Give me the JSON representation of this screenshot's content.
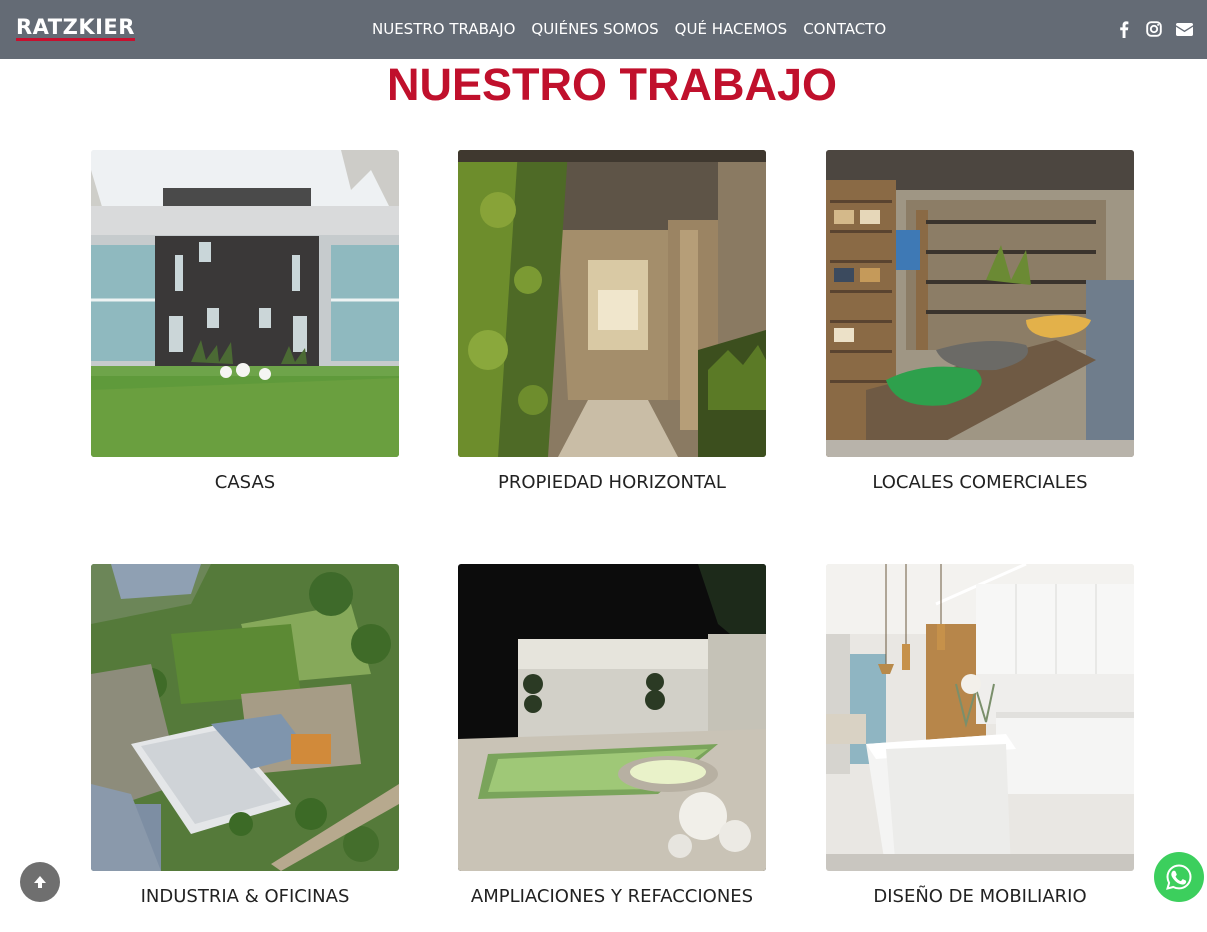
{
  "header": {
    "logo_text": "RATZKIER",
    "nav": [
      "NUESTRO TRABAJO",
      "QUIÉNES SOMOS",
      "QUÉ HACEMOS",
      "CONTACTO"
    ],
    "social_icons": [
      "facebook-icon",
      "instagram-icon",
      "envelope-icon"
    ]
  },
  "main": {
    "title": "NUESTRO TRABAJO",
    "cards": [
      {
        "label": "CASAS",
        "image": "house-photo"
      },
      {
        "label": "PROPIEDAD HORIZONTAL",
        "image": "atrium-photo"
      },
      {
        "label": "LOCALES COMERCIALES",
        "image": "store-photo"
      },
      {
        "label": "INDUSTRIA & OFICINAS",
        "image": "aerial-photo"
      },
      {
        "label": "AMPLIACIONES Y REFACCIONES",
        "image": "pool-photo"
      },
      {
        "label": "DISEÑO DE MOBILIARIO",
        "image": "kitchen-photo"
      }
    ]
  },
  "floating": {
    "scroll_top_icon": "arrow-up-icon",
    "whatsapp_icon": "whatsapp-icon"
  },
  "colors": {
    "navbar": "#646b75",
    "accent": "#c0102c",
    "whatsapp": "#3ccf5d"
  }
}
